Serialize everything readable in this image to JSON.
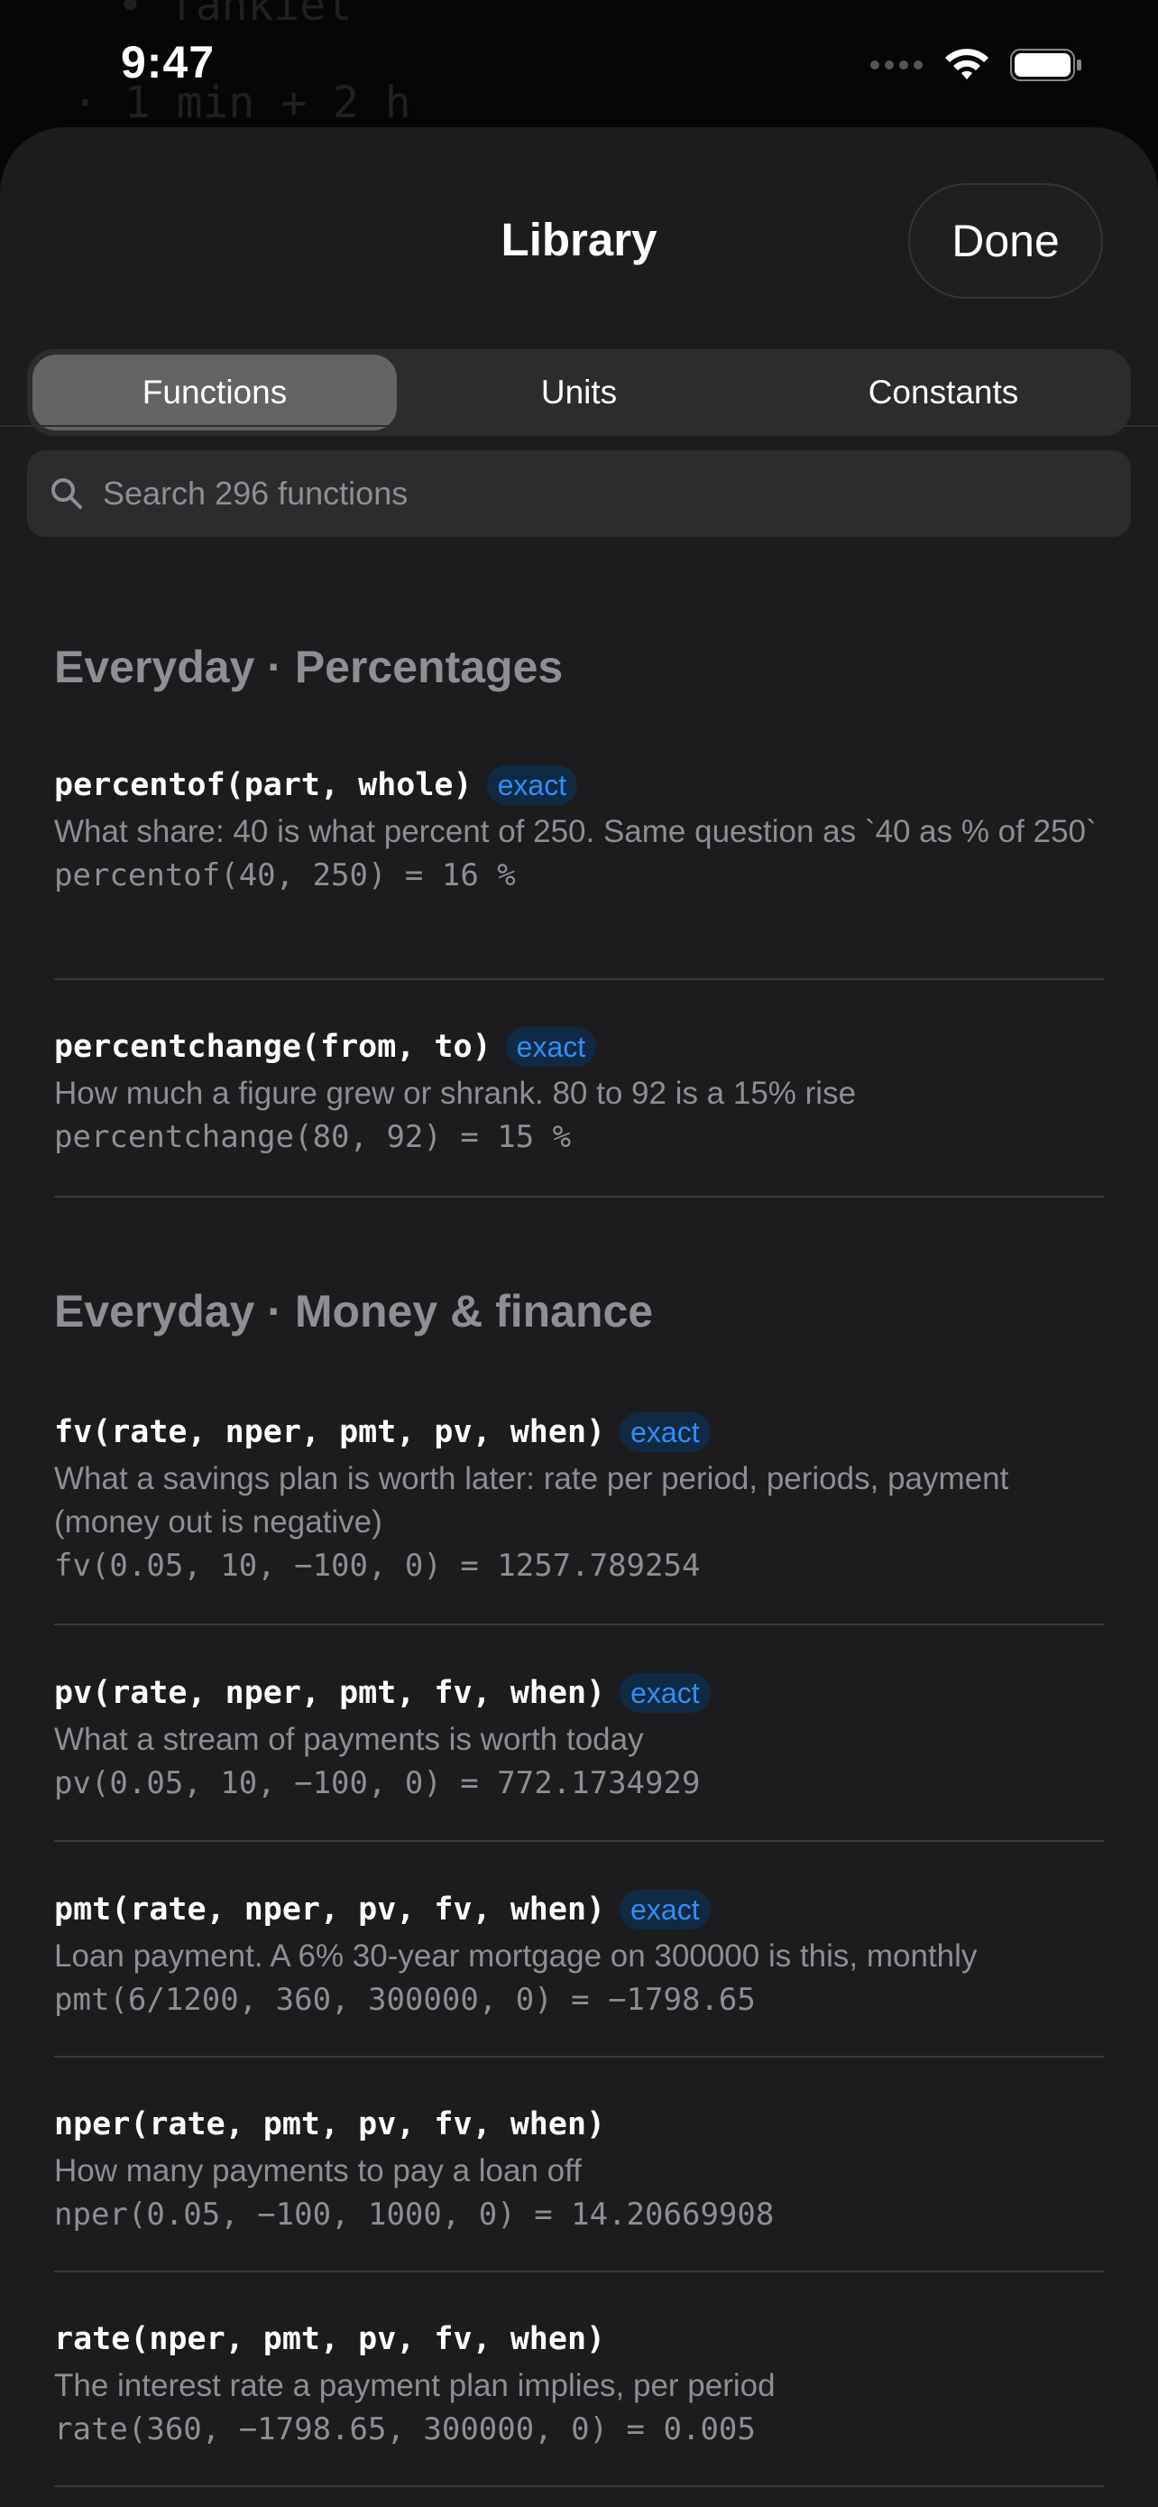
{
  "status": {
    "time": "9:47"
  },
  "header": {
    "title": "Library",
    "done_label": "Done"
  },
  "tabs": [
    {
      "label": "Functions",
      "active": true
    },
    {
      "label": "Units",
      "active": false
    },
    {
      "label": "Constants",
      "active": false
    }
  ],
  "search": {
    "placeholder": "Search 296 functions"
  },
  "sections": [
    {
      "title": "Everyday · Percentages",
      "items": [
        {
          "signature": "percentof(part, whole)",
          "badge": "exact",
          "description": "What share: 40 is what percent of 250. Same question as `40 as % of 250`",
          "example": "percentof(40, 250) = 16 %"
        },
        {
          "signature": "percentchange(from, to)",
          "badge": "exact",
          "description": "How much a figure grew or shrank. 80 to 92 is a 15% rise",
          "example": "percentchange(80, 92) = 15 %"
        }
      ]
    },
    {
      "title": "Everyday · Money & finance",
      "items": [
        {
          "signature": "fv(rate, nper, pmt, pv, when)",
          "badge": "exact",
          "description": "What a savings plan is worth later: rate per period, periods, payment (money out is negative)",
          "example": "fv(0.05, 10, −100, 0) = 1257.789254"
        },
        {
          "signature": "pv(rate, nper, pmt, fv, when)",
          "badge": "exact",
          "description": "What a stream of payments is worth today",
          "example": "pv(0.05, 10, −100, 0) = 772.1734929"
        },
        {
          "signature": "pmt(rate, nper, pv, fv, when)",
          "badge": "exact",
          "description": "Loan payment. A 6% 30-year mortgage on 300000 is this, monthly",
          "example": "pmt(6/1200, 360, 300000, 0) = −1798.65"
        },
        {
          "signature": "nper(rate, pmt, pv, fv, when)",
          "badge": "",
          "description": "How many payments to pay a loan off",
          "example": "nper(0.05, −100, 1000, 0) = 14.20669908"
        },
        {
          "signature": "rate(nper, pmt, pv, fv, when)",
          "badge": "",
          "description": "The interest rate a payment plan implies, per period",
          "example": "rate(360, −1798.65, 300000, 0) = 0.005"
        }
      ]
    }
  ]
}
